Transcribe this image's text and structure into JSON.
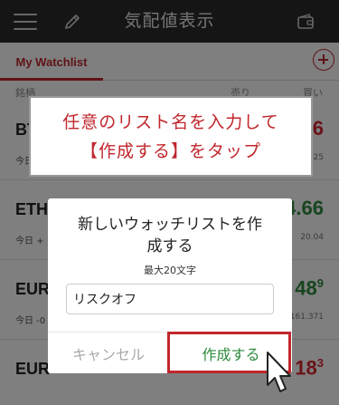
{
  "header": {
    "title": "気配値表示",
    "menu_icon": "hamburger-menu-icon",
    "edit_icon": "pencil-icon",
    "wallet_icon": "wallet-icon"
  },
  "tabs": {
    "active_label": "My Watchlist",
    "add_icon": "plus-circle-icon"
  },
  "columns": {
    "name": "銘柄",
    "sell": "売り",
    "buy": "買い"
  },
  "rows": [
    {
      "symbol": "BT",
      "sub": "今日",
      "price_tail": "6",
      "small": "25"
    },
    {
      "symbol": "ETH",
      "sub": "今日 +",
      "price_tail": "4.66",
      "small": "20.04"
    },
    {
      "symbol": "EUR",
      "sub": "今日 -0",
      "price_tail": "48",
      "price_sup": "9",
      "small": "161.371"
    },
    {
      "symbol": "EUR",
      "sub": "",
      "price_tail": "18",
      "price_sup": "3",
      "small": ""
    }
  ],
  "callout": {
    "line1": "任意のリスト名を入力して",
    "line2": "【作成する】をタップ"
  },
  "dialog": {
    "title_line1": "新しいウォッチリストを作",
    "title_line2": "成する",
    "limit": "最大20文字",
    "input_value": "リスクオフ",
    "cancel_label": "キャンセル",
    "create_label": "作成する"
  },
  "colors": {
    "accent": "#c1272d",
    "positive": "#2e8b3e",
    "header_bg": "#2b2b2b"
  }
}
